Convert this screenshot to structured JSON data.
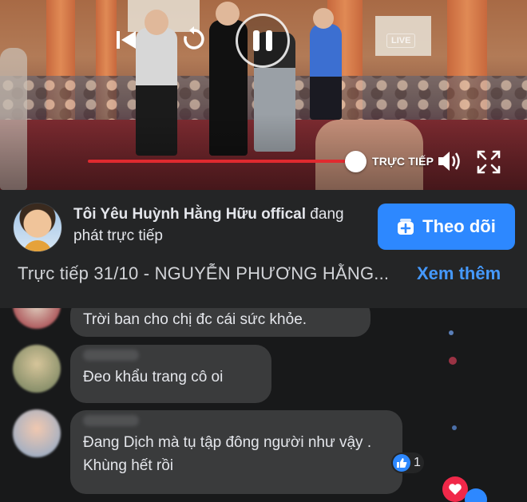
{
  "video": {
    "live_badge": "LIVE",
    "live_label": "TRỰC TIẾP",
    "progress_fraction": 0.97,
    "icons": {
      "prev": "skip-previous-icon",
      "replay": "replay-icon",
      "pause": "pause-icon",
      "volume": "volume-icon",
      "fullscreen": "fullscreen-icon"
    }
  },
  "stream_info": {
    "page_name": "Tôi Yêu Huỳnh Hằng Hữu offical",
    "status_text": " đang phát trực tiếp",
    "follow_label": "Theo dõi",
    "title": "Trực tiếp 31/10 - NGUYỄN PHƯƠNG HẰNG...",
    "see_more": "Xem thêm"
  },
  "comments": [
    {
      "text": "Trời ban cho chị đc cái sức khỏe."
    },
    {
      "text": "Đeo khẩu trang cô oi"
    },
    {
      "text": "Đang Dịch mà tụ tập đông người như vậy . Khùng hết rồi",
      "likes": "1"
    }
  ],
  "colors": {
    "accent": "#2d88ff",
    "progress": "#e02a2f",
    "link": "#4599ff",
    "background": "#18191a",
    "panel": "#242526",
    "bubble": "#3a3b3c"
  }
}
